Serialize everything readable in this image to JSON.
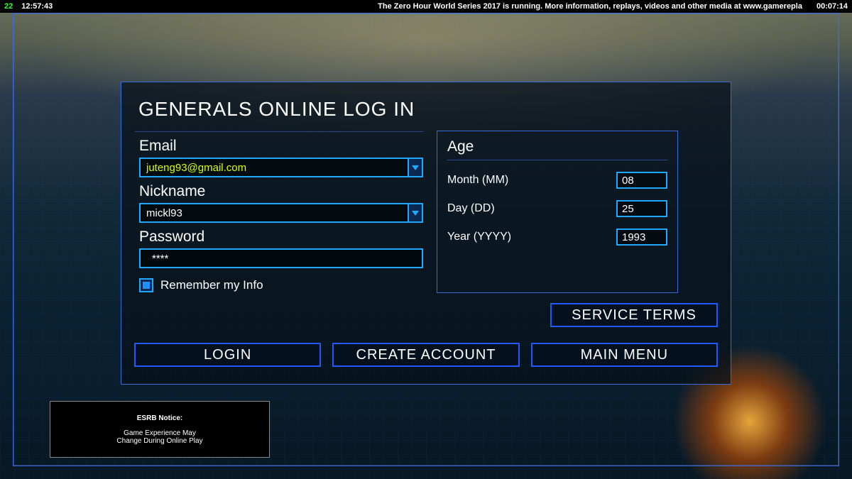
{
  "topbar": {
    "fps": "22",
    "clock": "12:57:43",
    "banner": "The Zero Hour World Series 2017 is running. More information, replays, videos and other media at www.gamerepla",
    "timer": "00:07:14"
  },
  "dialog": {
    "title": "GENERALS ONLINE LOG IN",
    "email_label": "Email",
    "email_value": "juteng93@gmail.com",
    "nickname_label": "Nickname",
    "nickname_value": "mickl93",
    "password_label": "Password",
    "password_value": "****",
    "remember_label": "Remember my Info",
    "remember_checked": true,
    "age": {
      "title": "Age",
      "month_label": "Month (MM)",
      "month_value": "08",
      "day_label": "Day (DD)",
      "day_value": "25",
      "year_label": "Year (YYYY)",
      "year_value": "1993"
    },
    "buttons": {
      "service_terms": "SERVICE TERMS",
      "login": "LOGIN",
      "create_account": "CREATE ACCOUNT",
      "main_menu": "MAIN MENU"
    }
  },
  "esrb": {
    "title": "ESRB Notice:",
    "line1": "Game Experience May",
    "line2": "Change During Online Play"
  }
}
